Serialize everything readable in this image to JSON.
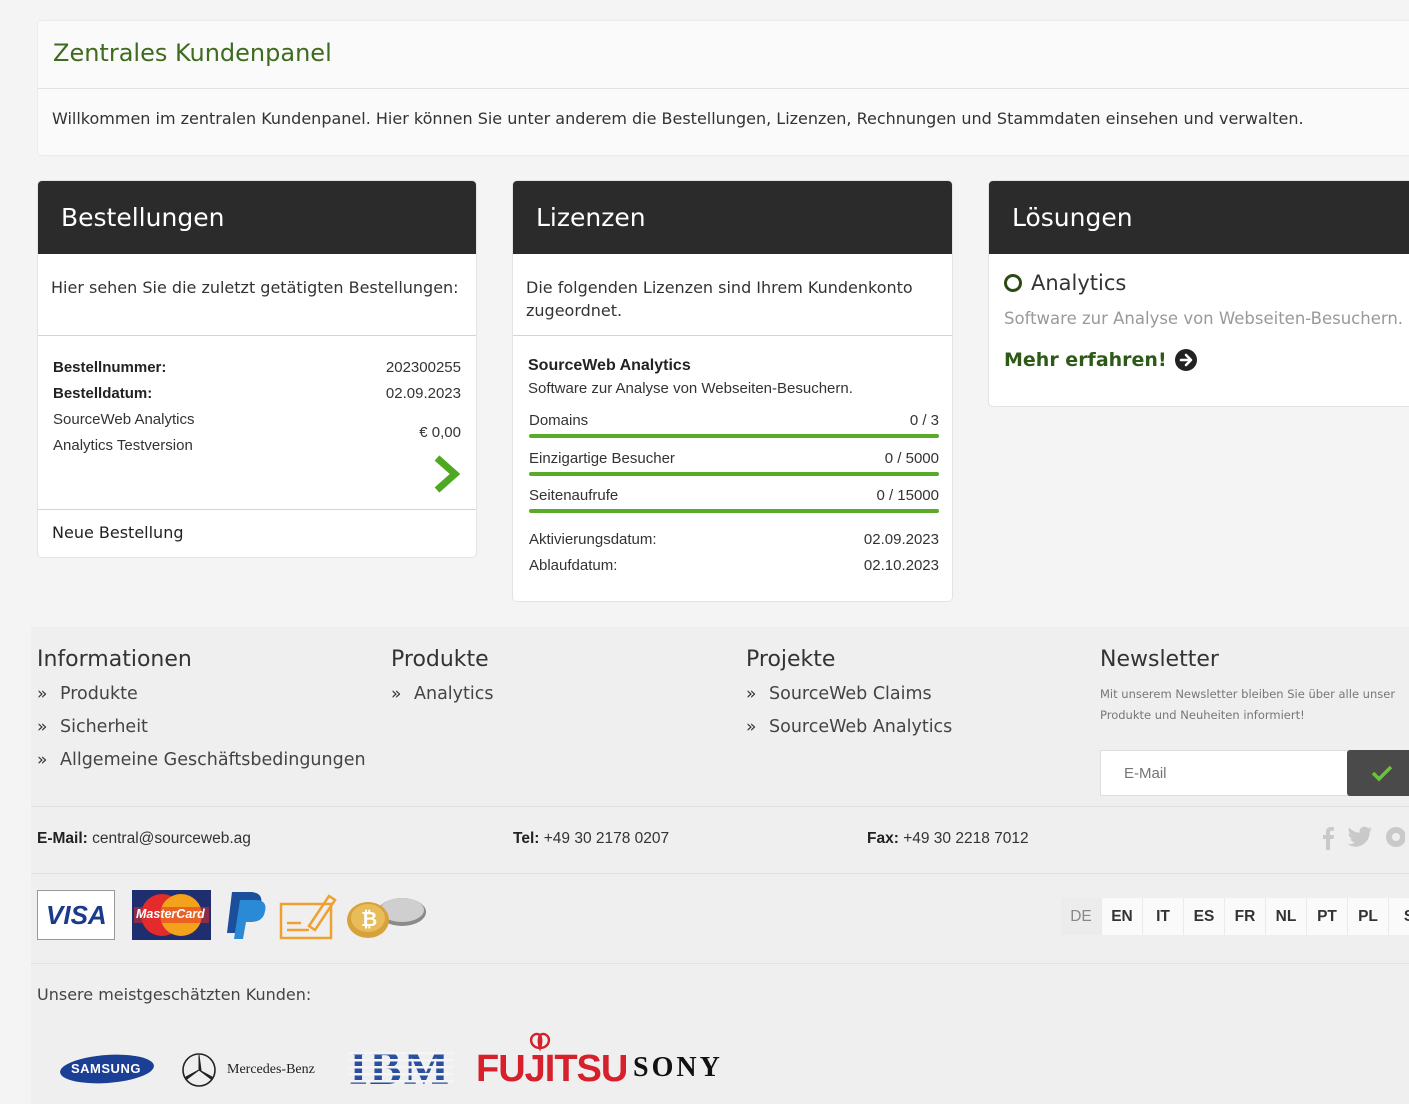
{
  "welcome": {
    "title": "Zentrales Kundenpanel",
    "text": "Willkommen im zentralen Kundenpanel. Hier können Sie unter anderem die Bestellungen, Lizenzen, Rechnungen und Stammdaten einsehen und verwalten."
  },
  "orders": {
    "title": "Bestellungen",
    "intro": "Hier sehen Sie die zuletzt getätigten Bestellungen:",
    "order_number_label": "Bestellnummer:",
    "order_number": "202300255",
    "order_date_label": "Bestelldatum:",
    "order_date": "02.09.2023",
    "item_product": "SourceWeb Analytics",
    "item_variant": "Analytics Testversion",
    "price": "€ 0,00",
    "new_order": "Neue Bestellung"
  },
  "licenses": {
    "title": "Lizenzen",
    "intro": "Die folgenden Lizenzen sind Ihrem Kundenkonto zugeordnet.",
    "product_name": "SourceWeb Analytics",
    "product_desc": "Software zur Analyse von Webseiten-Besuchern.",
    "meters": [
      {
        "label": "Domains",
        "value": "0 / 3",
        "fraction": 0
      },
      {
        "label": "Einzigartige Besucher",
        "value": "0 / 5000",
        "fraction": 0
      },
      {
        "label": "Seitenaufrufe",
        "value": "0 / 15000",
        "fraction": 0
      }
    ],
    "activation_label": "Aktivierungsdatum:",
    "activation_date": "02.09.2023",
    "expiry_label": "Ablaufdatum:",
    "expiry_date": "02.10.2023"
  },
  "solutions": {
    "title": "Lösungen",
    "item_title": "Analytics",
    "item_desc": "Software zur Analyse von Webseiten-Besuchern.",
    "more": "Mehr erfahren!"
  },
  "footer": {
    "info": {
      "title": "Informationen",
      "links": [
        "Produkte",
        "Sicherheit",
        "Allgemeine Geschäftsbedingungen"
      ]
    },
    "products": {
      "title": "Produkte",
      "links": [
        "Analytics"
      ]
    },
    "projects": {
      "title": "Projekte",
      "links": [
        "SourceWeb Claims",
        "SourceWeb Analytics"
      ]
    },
    "newsletter": {
      "title": "Newsletter",
      "text_line1": "Mit unserem Newsletter bleiben Sie über alle unser",
      "text_line2": "Produkte und Neuheiten informiert!",
      "placeholder": "E-Mail"
    },
    "contact": {
      "email_label": "E-Mail:",
      "email": "central@sourceweb.ag",
      "tel_label": "Tel:",
      "tel": "+49 30 2178 0207",
      "fax_label": "Fax:",
      "fax": "+49 30 2218 7012"
    },
    "social_icons": [
      "facebook-icon",
      "twitter-icon",
      "pinterest-icon"
    ],
    "payment": {
      "visa": "VISA",
      "mastercard": "MasterCard",
      "icons": [
        "visa-logo",
        "mastercard-logo",
        "paypal-logo",
        "cheque-icon",
        "bitcoin-icon"
      ]
    },
    "languages": [
      "DE",
      "EN",
      "IT",
      "ES",
      "FR",
      "NL",
      "PT",
      "PL",
      "S"
    ],
    "active_language": "DE",
    "clients_label": "Unsere meistgeschätzten Kunden:",
    "clients": {
      "samsung": "SAMSUNG",
      "mercedes": "Mercedes-Benz",
      "ibm": "IBM",
      "fujitsu": "FUJITSU",
      "sony": "SONY"
    }
  },
  "colors": {
    "accent_green": "#3f6b1f",
    "bar_green": "#5aaa2a",
    "header_dark": "#2b2b2b"
  }
}
